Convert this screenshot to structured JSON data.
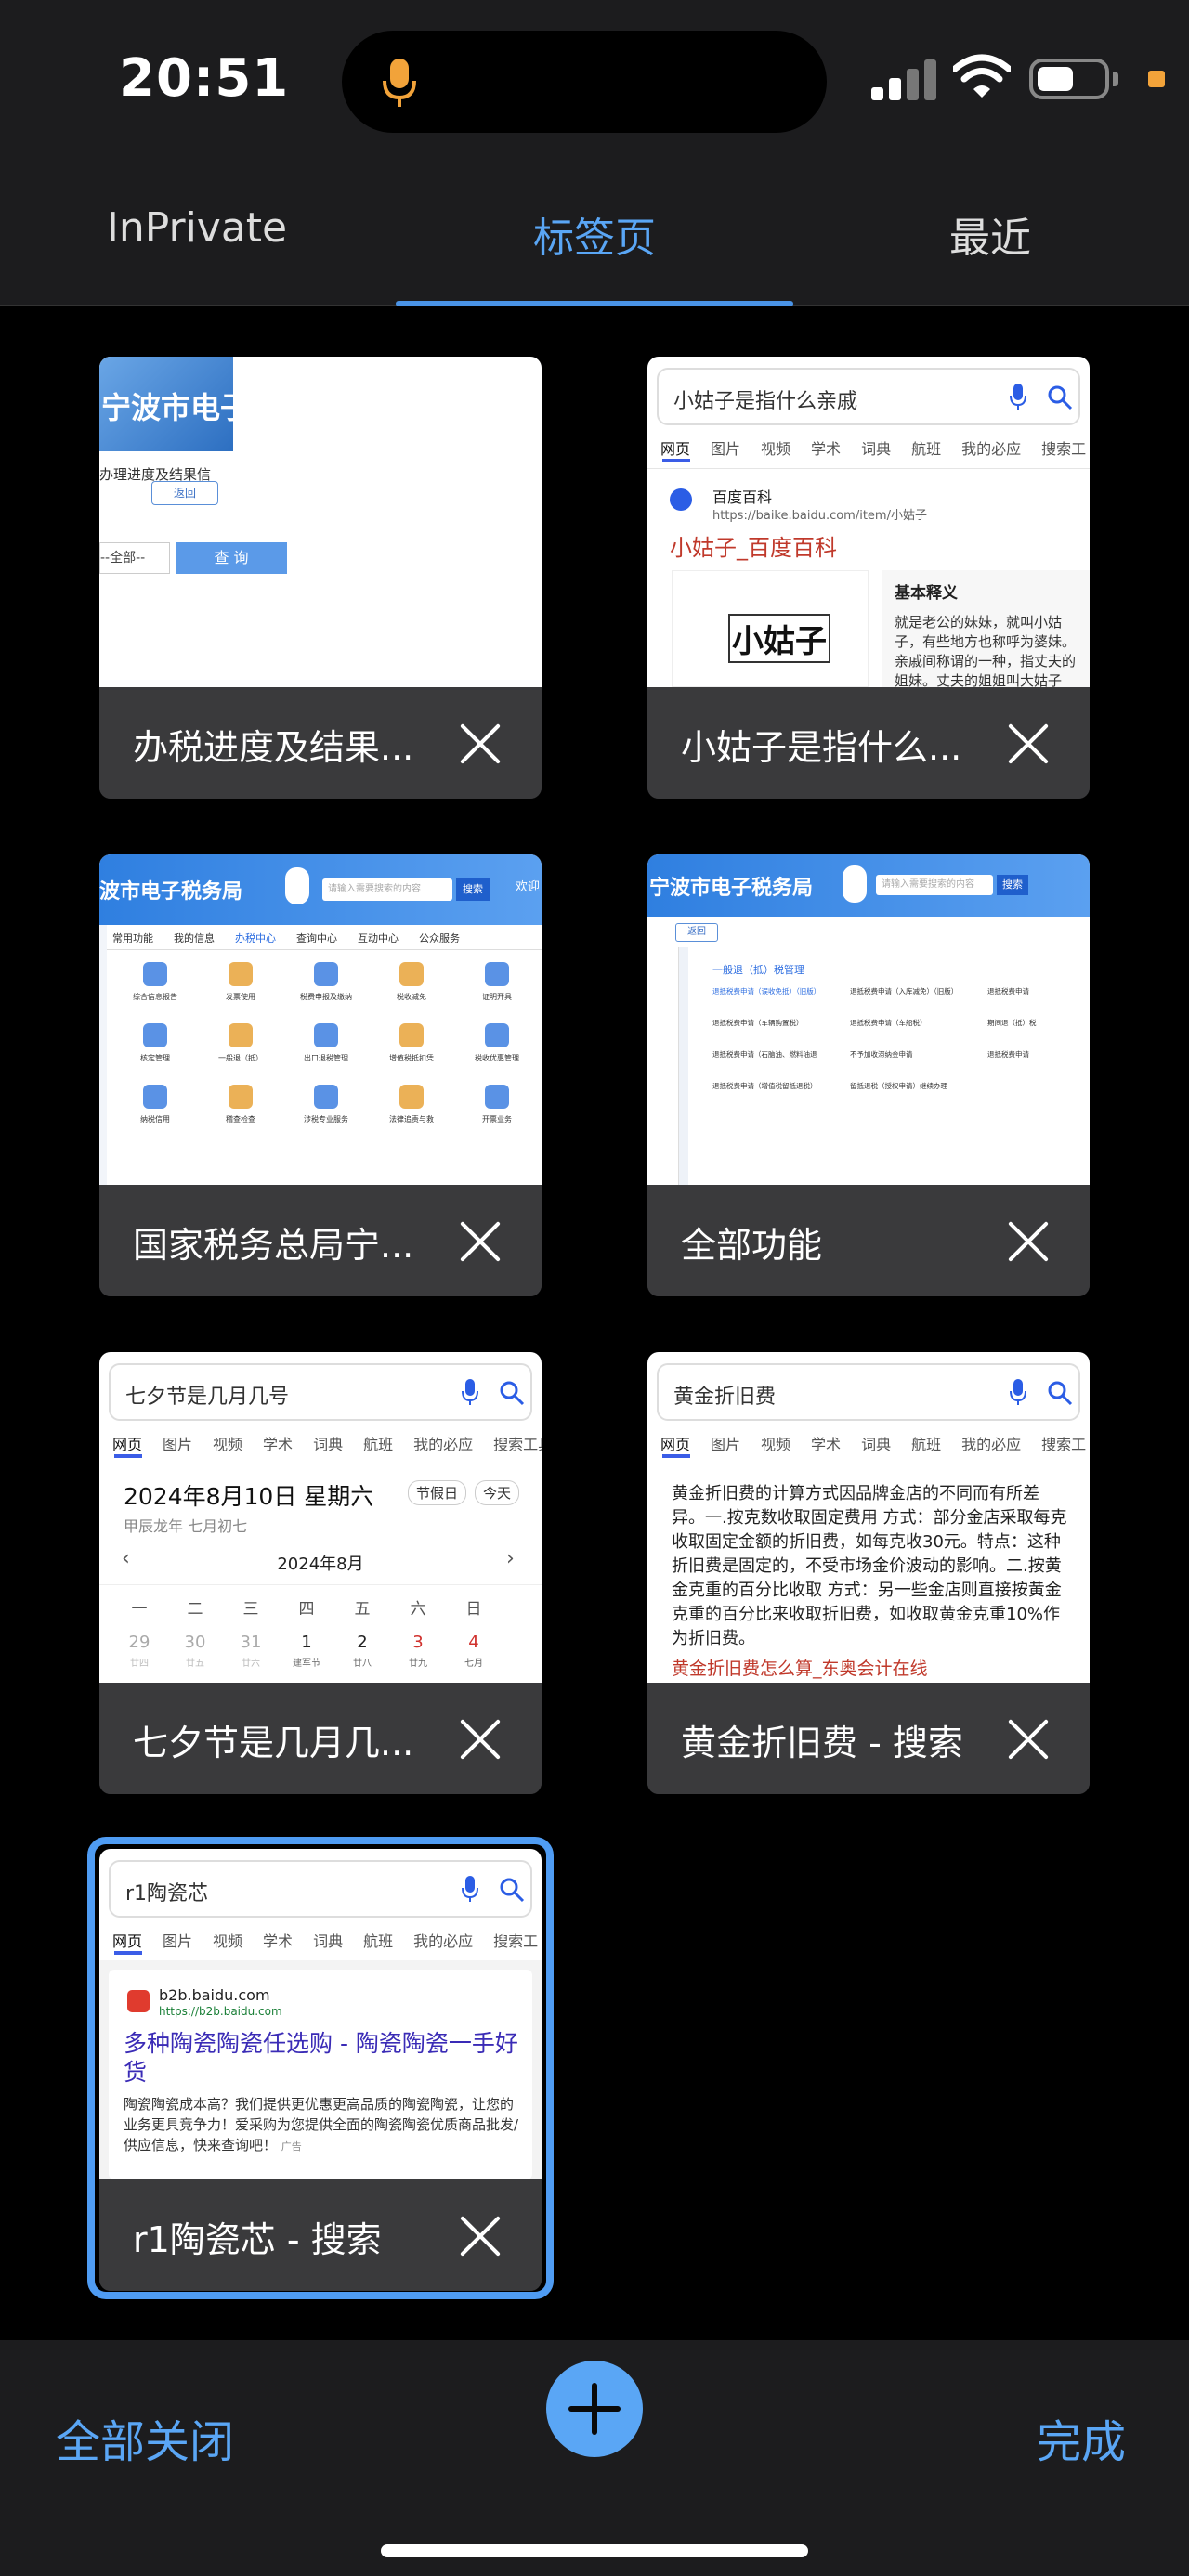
{
  "status": {
    "time": "20:51"
  },
  "header": {
    "tabs": [
      {
        "label": "InPrivate"
      },
      {
        "label": "标签页"
      },
      {
        "label": "最近"
      }
    ]
  },
  "cards": [
    {
      "title": "办税进度及结果...",
      "preview": {
        "banner": "宁波市电子",
        "line1": "办理进度及结果信",
        "back": "返回",
        "select": "--全部--",
        "query": "查 询"
      }
    },
    {
      "title": "小姑子是指什么...",
      "preview": {
        "query": "小姑子是指什么亲戚",
        "tabs": [
          "网页",
          "图片",
          "视频",
          "学术",
          "词典",
          "航班",
          "我的必应",
          "搜索工"
        ],
        "source": "百度百科",
        "url": "https://baike.baidu.com/item/小姑子",
        "result_title": "小姑子_百度百科",
        "image_text": "小姑子",
        "side_heading": "基本释义",
        "side_text": "就是老公的妹妹，就叫小姑子，有些地方也称呼为婆妹。亲戚间称谓的一种，指丈夫的姐妹。丈夫的姐姐叫大姑子"
      }
    },
    {
      "title": "国家税务总局宁...",
      "preview": {
        "banner": "波市电子税务局",
        "search_placeholder": "请输入需要搜索的内容",
        "search_btn": "搜索",
        "welcome": "欢迎",
        "tabs": [
          "常用功能",
          "我的信息",
          "办税中心",
          "查询中心",
          "互动中心",
          "公众服务"
        ],
        "icons": [
          "综合信息报告",
          "发票使用",
          "税费申报及缴纳",
          "税收减免",
          "证明开具",
          "核定管理",
          "一般退（抵）",
          "出口退税管理",
          "增值税抵扣凭",
          "税收优惠管理",
          "纳税信用",
          "稽查检查",
          "涉税专业服务",
          "法律追责与救",
          "开票业务"
        ]
      }
    },
    {
      "title": "全部功能",
      "preview": {
        "banner": "宁波市电子税务局",
        "search_placeholder": "请输入需要搜索的内容",
        "search_btn": "搜索",
        "back": "返回",
        "section": "一般退（抵）税管理",
        "links": [
          "退抵税费申请（误收免抵）（旧版）",
          "退抵税费申请（入库减免）（旧版）",
          "退抵税费申请",
          "退抵税费申请（车辆购置税）",
          "退抵税费申请（车船税）",
          "期间退（抵）税",
          "退抵税费申请（石脑油、燃料油退",
          "不予加收滞纳金申请",
          "退抵税费申请",
          "退抵税费申请（增值税留抵退税）",
          "留抵退税（授权申请）继续办理"
        ]
      }
    },
    {
      "title": "七夕节是几月几...",
      "preview": {
        "query": "七夕节是几月几号",
        "tabs": [
          "网页",
          "图片",
          "视频",
          "学术",
          "词典",
          "航班",
          "我的必应",
          "搜索工具"
        ],
        "date": "2024年8月10日 星期六",
        "badge1": "节假日",
        "badge2": "今天",
        "lunar": "甲辰龙年 七月初七",
        "month": "2024年8月",
        "weekdays": [
          "一",
          "二",
          "三",
          "四",
          "五",
          "六",
          "日"
        ],
        "days": [
          "29",
          "30",
          "31",
          "1",
          "2",
          "3",
          "4"
        ],
        "subs": [
          "廿四",
          "廿五",
          "廿六",
          "建军节",
          "廿八",
          "廿九",
          "七月"
        ]
      }
    },
    {
      "title": "黄金折旧费 - 搜索",
      "preview": {
        "query": "黄金折旧费",
        "tabs": [
          "网页",
          "图片",
          "视频",
          "学术",
          "词典",
          "航班",
          "我的必应",
          "搜索工"
        ],
        "answer": "黄金折旧费的计算方式因品牌金店的不同而有所差异。一.按克数收取固定费用 方式：部分金店采取每克收取固定金额的折旧费，如每克收30元。特点：这种折旧费是固定的，不受市场金价波动的影响。二.按黄金克重的百分比收取 方式：另一些金店则直接按黄金克重的百分比来收取折旧费，如收取黄金克重10%作为折旧费。",
        "link": "黄金折旧费怎么算_东奥会计在线"
      }
    },
    {
      "title": "r1陶瓷芯 - 搜索",
      "preview": {
        "query": "r1陶瓷芯",
        "tabs": [
          "网页",
          "图片",
          "视频",
          "学术",
          "词典",
          "航班",
          "我的必应",
          "搜索工"
        ],
        "site": "b2b.baidu.com",
        "url": "https://b2b.baidu.com",
        "ad_title": "多种陶瓷陶瓷任选购 - 陶瓷陶瓷一手好货",
        "ad_text": "陶瓷陶瓷成本高？我们提供更优惠更高品质的陶瓷陶瓷，让您的业务更具竞争力！爱采购为您提供全面的陶瓷陶瓷优质商品批发/供应信息，快来查询吧！",
        "ad_label": "广告"
      }
    }
  ],
  "bottom": {
    "close_all": "全部关闭",
    "done": "完成"
  },
  "colors": {
    "accent": "#5aa6f5",
    "card_footer": "#3a3a3c",
    "bar_bg": "#1c1c1e"
  }
}
